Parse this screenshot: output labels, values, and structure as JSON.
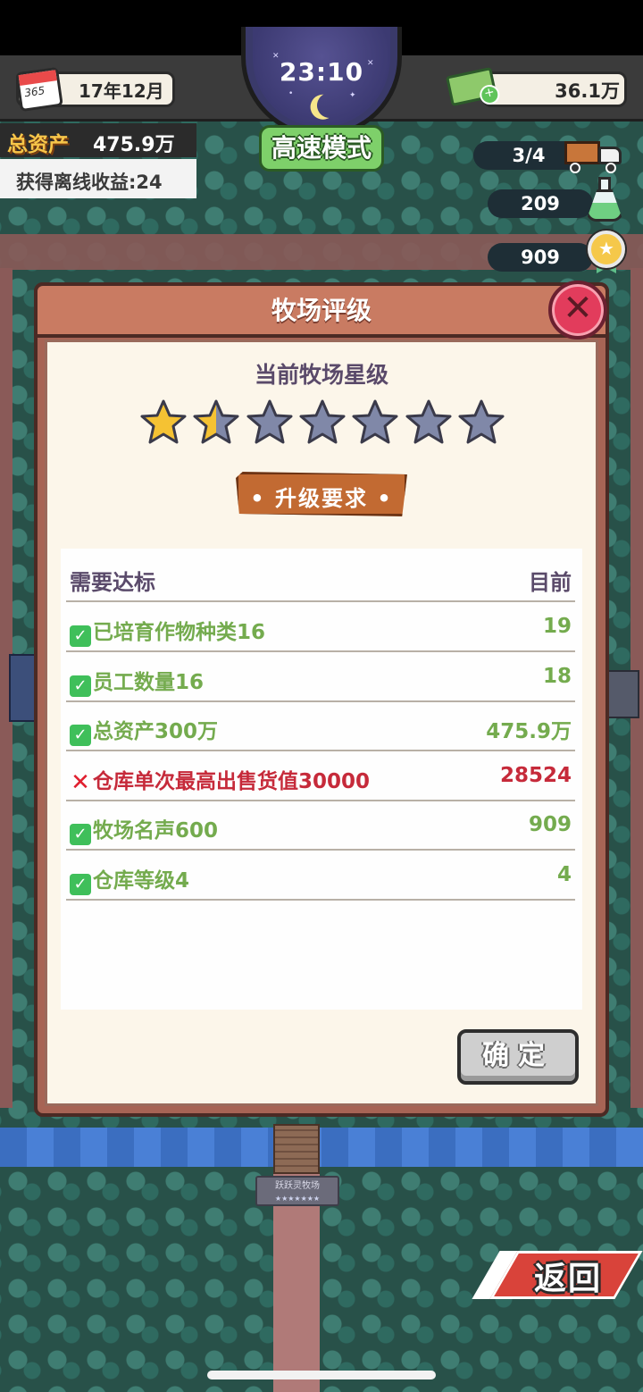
{
  "hud": {
    "date": "17年12月",
    "calendar_label": "365",
    "clock_time": "23:10",
    "speed_mode": "高速模式",
    "money": "36.1万",
    "total_assets_label": "总资产",
    "total_assets_value": "475.9万",
    "offline_income": "获得离线收益:24",
    "trucks": "3/4",
    "research": "209",
    "reputation": "909"
  },
  "dialog": {
    "title": "牧场评级",
    "current_star_heading": "当前牧场星级",
    "star_rating": 1.5,
    "star_max": 7,
    "upgrade_banner": "• 升级要求 •",
    "table_header": {
      "requirement": "需要达标",
      "current": "目前"
    },
    "requirements": [
      {
        "status": "met",
        "label": "已培育作物种类16",
        "current": "19"
      },
      {
        "status": "met",
        "label": "员工数量16",
        "current": "18"
      },
      {
        "status": "met",
        "label": "总资产300万",
        "current": "475.9万"
      },
      {
        "status": "unmet",
        "label": "仓库单次最高出售货值30000",
        "current": "28524"
      },
      {
        "status": "met",
        "label": "牧场名声600",
        "current": "909"
      },
      {
        "status": "met",
        "label": "仓库等级4",
        "current": "4"
      }
    ],
    "confirm_label": "确定"
  },
  "back_label": "返回",
  "scene": {
    "ranch_sign": "跃跃灵牧场",
    "ranch_sign_stars": "★★★★★★★"
  },
  "colors": {
    "met": "#74ab4e",
    "unmet": "#c62a3a",
    "star_gold": "#f5c233",
    "star_empty": "#8088a8"
  },
  "icons": [
    "calendar-icon",
    "moon-icon",
    "money-icon",
    "truck-icon",
    "flask-icon",
    "medal-icon",
    "close-icon",
    "check-icon",
    "cross-icon",
    "star-icon"
  ]
}
